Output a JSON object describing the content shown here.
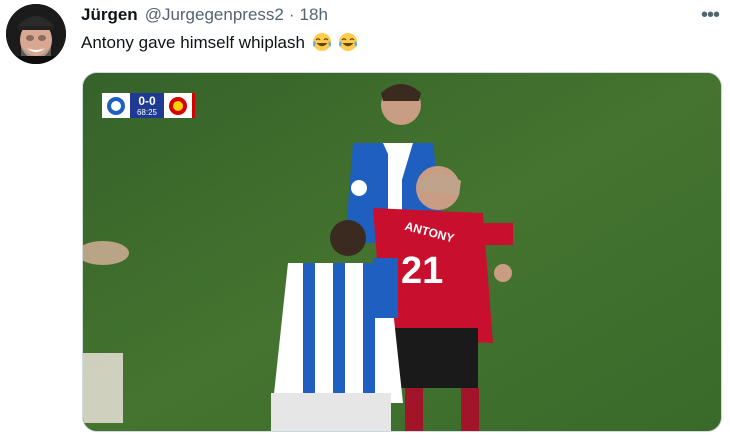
{
  "tweet": {
    "author_name": "Jürgen",
    "handle": "@Jurgegenpress2",
    "separator": "·",
    "time": "18h",
    "text": "Antony gave himself whiplash ",
    "emoji": [
      "face-with-tears-of-joy",
      "face-with-tears-of-joy"
    ],
    "more_label": "•••"
  },
  "media": {
    "score": "0-0",
    "clock": "68:25",
    "player_name": "ANTONY",
    "player_number": "21"
  },
  "colors": {
    "text_primary": "#0f1419",
    "text_secondary": "#536471",
    "pitch": "#3e6a2e",
    "home_kit": "#1f5fbf",
    "away_kit": "#c8102e"
  }
}
